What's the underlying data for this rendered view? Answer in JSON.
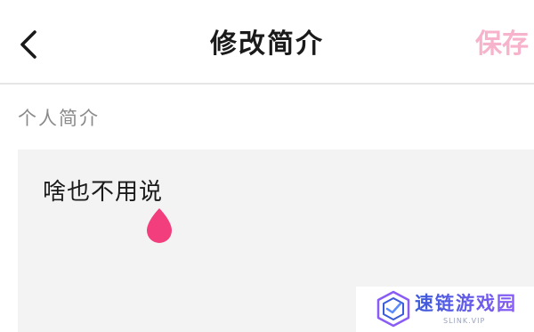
{
  "header": {
    "title": "修改简介",
    "save_label": "保存",
    "back_icon": "chevron-left-icon"
  },
  "bio": {
    "section_label": "个人简介",
    "value": "啥也不用说",
    "cursor_handle_icon": "text-cursor-handle-icon"
  },
  "watermark": {
    "name": "速链游戏园",
    "sub": "SLINK.VIP",
    "logo_icon": "cube-logo-icon"
  },
  "colors": {
    "accent_disabled": "#f7b3cb",
    "cursor_handle": "#f23e7c",
    "text_primary": "#1a1a1a",
    "text_secondary": "#8a8a8a",
    "input_background": "#f3f3f4",
    "watermark_blue": "#3b5bdb",
    "watermark_purple": "#8a5cf6"
  }
}
